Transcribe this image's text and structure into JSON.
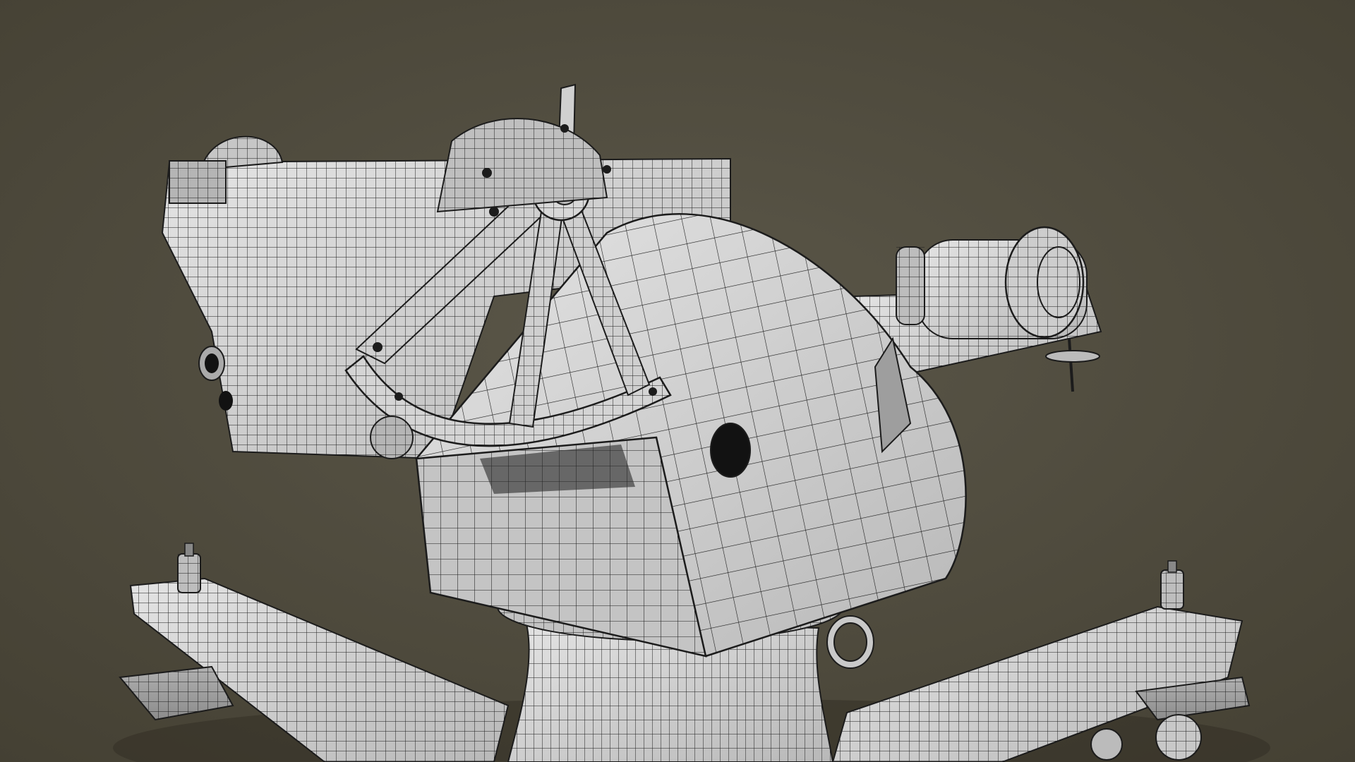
{
  "scene": {
    "subject": "wireframe-render-mount",
    "colors": {
      "background_center": "#5b5749",
      "background_edge": "#444033",
      "surface": "#cfcfcf",
      "surface_dark": "#9a9a9a",
      "surface_light": "#e6e6e6",
      "wire": "#1c1c1c",
      "hole": "#121212"
    },
    "icons": [
      "rotating-turret",
      "quadrant-arc",
      "spoked-handwheel",
      "sight-cylinder",
      "cross-base-rails",
      "lifting-ring"
    ]
  }
}
